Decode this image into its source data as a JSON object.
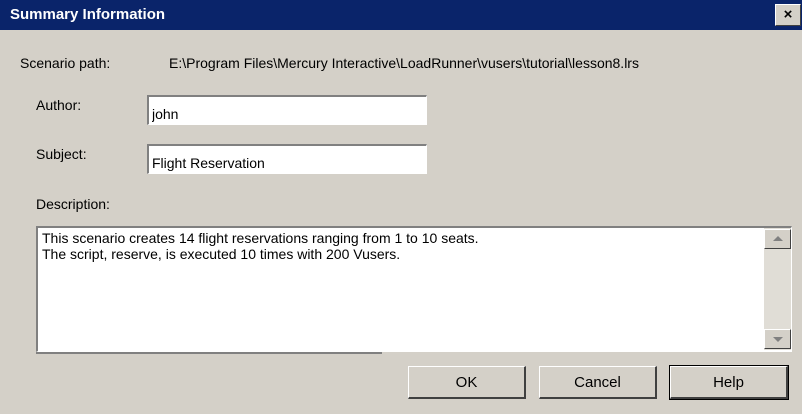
{
  "window": {
    "title": "Summary Information",
    "close_glyph": "×"
  },
  "scenario_path": {
    "label": "Scenario path:",
    "value": "E:\\Program Files\\Mercury Interactive\\LoadRunner\\vusers\\tutorial\\lesson8.lrs"
  },
  "author": {
    "label": "Author:",
    "value": "john"
  },
  "subject": {
    "label": "Subject:",
    "value": "Flight Reservation"
  },
  "description": {
    "label": "Description:",
    "value": "This scenario creates 14 flight reservations ranging from 1 to 10 seats.\nThe script, reserve, is executed 10 times with 200 Vusers."
  },
  "buttons": {
    "ok": "OK",
    "cancel": "Cancel",
    "help": "Help"
  }
}
